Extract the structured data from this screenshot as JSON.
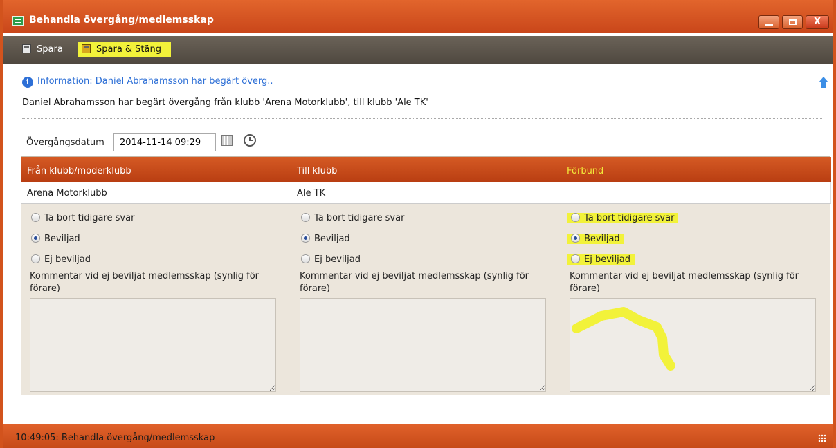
{
  "window": {
    "title": "Behandla övergång/medlemsskap",
    "controls": {
      "minimize": "minimize-icon",
      "maximize": "maximize-icon",
      "close": "X"
    }
  },
  "toolbar": {
    "save_label": "Spara",
    "save_close_label": "Spara & Stäng"
  },
  "info": {
    "title": "Information: Daniel Abrahamsson har begärt överg..",
    "message": "Daniel Abrahamsson har begärt övergång från klubb 'Arena Motorklubb', till klubb 'Ale TK'"
  },
  "transfer": {
    "date_label": "Övergångsdatum",
    "date_value": "2014-11-14 09:29"
  },
  "columns": [
    {
      "header": "Från klubb/moderklubb",
      "value": "Arena Motorklubb",
      "options": [
        "Ta bort tidigare svar",
        "Beviljad",
        "Ej beviljad"
      ],
      "selected": "Beviljad",
      "comment_label": "Kommentar vid ej beviljat medlemsskap (synlig för förare)",
      "comment_value": ""
    },
    {
      "header": "Till klubb",
      "value": "Ale TK",
      "options": [
        "Ta bort tidigare svar",
        "Beviljad",
        "Ej beviljad"
      ],
      "selected": "Beviljad",
      "comment_label": "Kommentar vid ej beviljat medlemsskap (synlig för förare)",
      "comment_value": ""
    },
    {
      "header": "Förbund",
      "value": "",
      "options": [
        "Ta bort tidigare svar",
        "Beviljad",
        "Ej beviljad"
      ],
      "selected": "Beviljad",
      "comment_label": "Kommentar vid ej beviljat medlemsskap (synlig för förare)",
      "comment_value": ""
    }
  ],
  "status": {
    "text": "10:49:05: Behandla övergång/medlemsskap"
  },
  "colors": {
    "accent": "#d2531d",
    "toolbar": "#5a5249",
    "highlight": "#f2f23a",
    "info_blue": "#2d6fd6"
  }
}
